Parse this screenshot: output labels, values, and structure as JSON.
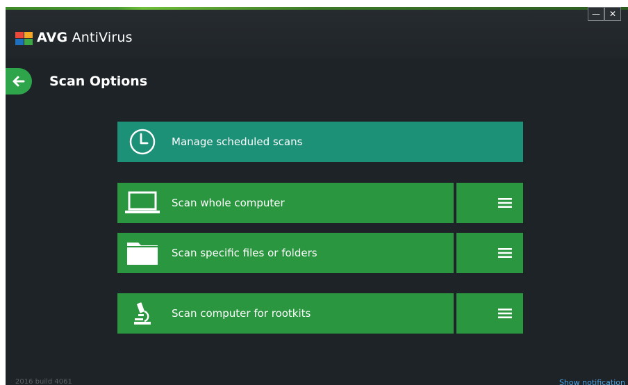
{
  "window": {
    "brand": "AVG",
    "product": "AntiVirus",
    "minimize_glyph": "—",
    "close_glyph": "✕"
  },
  "header": {
    "back_icon": "arrow-left-icon",
    "title": "Scan Options"
  },
  "tiles": [
    {
      "label": "Manage scheduled scans",
      "icon": "clock-icon",
      "color": "#1d9078",
      "has_menu": false
    },
    {
      "label": "Scan whole computer",
      "icon": "laptop-icon",
      "color": "#2b9640",
      "has_menu": true
    },
    {
      "label": "Scan specific files or folders",
      "icon": "folder-icon",
      "color": "#2b9640",
      "has_menu": true
    },
    {
      "label": "Scan computer for rootkits",
      "icon": "microscope-icon",
      "color": "#2b9640",
      "has_menu": true
    }
  ],
  "footer": {
    "version": "2016  build 4061",
    "notification_link": "Show notification"
  },
  "colors": {
    "background": "#1e2327",
    "accent_green": "#2ea54a",
    "teal": "#1d9078"
  }
}
